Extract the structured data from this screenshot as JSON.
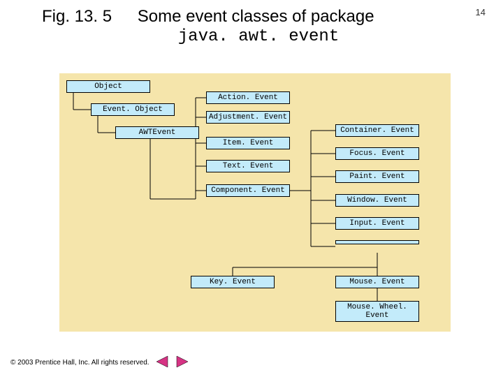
{
  "page_number": "14",
  "figure": {
    "label": "Fig. 13. 5",
    "title_prefix": "Some event classes of package",
    "title_code": "java. awt. event"
  },
  "nodes": {
    "object": "Object",
    "event_object": "Event. Object",
    "awt_event": "AWTEvent",
    "action_event": "Action. Event",
    "adjustment_event": "Adjustment. Event",
    "item_event": "Item. Event",
    "text_event": "Text. Event",
    "component_event": "Component. Event",
    "container_event": "Container. Event",
    "focus_event": "Focus. Event",
    "paint_event": "Paint. Event",
    "window_event": "Window. Event",
    "input_event": "Input. Event",
    "key_event": "Key. Event",
    "mouse_event": "Mouse. Event",
    "mouse_wheel_event": "Mouse. Wheel. Event"
  },
  "footer": {
    "copyright": "© 2003 Prentice Hall, Inc.  All rights reserved."
  }
}
